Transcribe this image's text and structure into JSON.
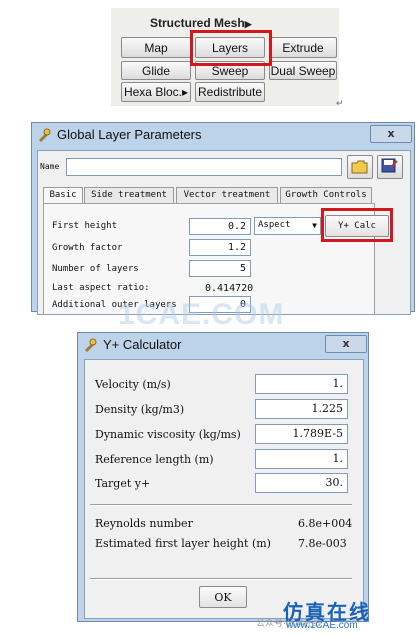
{
  "structured_mesh": {
    "title": "Structured Mesh",
    "title_arrow": "▶",
    "buttons": {
      "map": "Map",
      "layers": "Layers",
      "extrude": "Extrude",
      "glide": "Glide",
      "sweep": "Sweep",
      "dual_sweep": "Dual Sweep",
      "hexa_block": "Hexa Bloc.▸",
      "redistribute": "Redistribute"
    },
    "enter_mark": "↵"
  },
  "global_layer": {
    "title": "Global Layer Parameters",
    "close": "x",
    "name_label": "Name",
    "name_value": "",
    "tabs": [
      "Basic",
      "Side treatment",
      "Vector treatment",
      "Growth Controls"
    ],
    "first_height_label": "First height",
    "first_height_value": "0.2",
    "aspect_option": "Aspect",
    "yplus_button": "Y+ Calc",
    "growth_factor_label": "Growth factor",
    "growth_factor_value": "1.2",
    "num_layers_label": "Number of layers",
    "num_layers_value": "5",
    "last_aspect_label": "Last aspect ratio:",
    "last_aspect_value": "0.414720",
    "additional_label": "Additional outer layers",
    "additional_value": "0"
  },
  "watermark": "1CAE.COM",
  "yplus": {
    "title": "Y+ Calculator",
    "close": "x",
    "velocity_label": "Velocity (m/s)",
    "velocity_value": "1.",
    "density_label": "Density (kg/m3)",
    "density_value": "1.225",
    "viscosity_label": "Dynamic viscosity (kg/ms)",
    "viscosity_value": "1.789E-5",
    "ref_length_label": "Reference length (m)",
    "ref_length_value": "1.",
    "target_label": "Target y+",
    "target_value": "30.",
    "reynolds_label": "Reynolds number",
    "reynolds_value": "6.8e+004",
    "est_height_label": "Estimated first layer height (m)",
    "est_height_value": "7.8e-003",
    "ok": "OK"
  },
  "footer": {
    "brand_cn": "仿真在线",
    "brand_url": "www.1CAE.com",
    "small": "公众号·仿真在线"
  },
  "colors": {
    "highlight": "#d3171f",
    "titlebar": "#bcd3ea"
  }
}
